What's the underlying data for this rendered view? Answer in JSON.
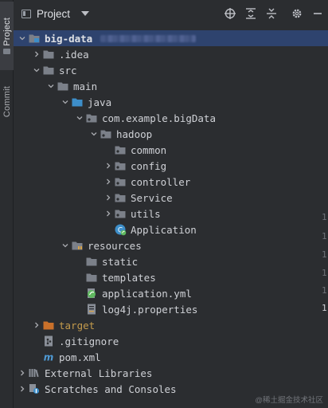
{
  "sidebar": {
    "project_tab": "Project",
    "commit_tab": "Commit"
  },
  "header": {
    "title": "Project"
  },
  "tree": [
    {
      "label": "big-data",
      "depth": 0,
      "arrow": "down",
      "icon": "module-folder",
      "selected": true,
      "bold": true,
      "blurred_path": true
    },
    {
      "label": ".idea",
      "depth": 1,
      "arrow": "right",
      "icon": "folder"
    },
    {
      "label": "src",
      "depth": 1,
      "arrow": "down",
      "icon": "folder"
    },
    {
      "label": "main",
      "depth": 2,
      "arrow": "down",
      "icon": "folder"
    },
    {
      "label": "java",
      "depth": 3,
      "arrow": "down",
      "icon": "source-folder"
    },
    {
      "label": "com.example.bigData",
      "depth": 4,
      "arrow": "down",
      "icon": "package"
    },
    {
      "label": "hadoop",
      "depth": 5,
      "arrow": "down",
      "icon": "package"
    },
    {
      "label": "common",
      "depth": 6,
      "arrow": "none",
      "icon": "package"
    },
    {
      "label": "config",
      "depth": 6,
      "arrow": "right",
      "icon": "package"
    },
    {
      "label": "controller",
      "depth": 6,
      "arrow": "right",
      "icon": "package"
    },
    {
      "label": "Service",
      "depth": 6,
      "arrow": "right",
      "icon": "package"
    },
    {
      "label": "utils",
      "depth": 6,
      "arrow": "right",
      "icon": "package"
    },
    {
      "label": "Application",
      "depth": 6,
      "arrow": "none",
      "icon": "spring-class"
    },
    {
      "label": "resources",
      "depth": 3,
      "arrow": "down",
      "icon": "resources-folder"
    },
    {
      "label": "static",
      "depth": 4,
      "arrow": "none",
      "icon": "folder"
    },
    {
      "label": "templates",
      "depth": 4,
      "arrow": "none",
      "icon": "folder"
    },
    {
      "label": "application.yml",
      "depth": 4,
      "arrow": "none",
      "icon": "spring-yml"
    },
    {
      "label": "log4j.properties",
      "depth": 4,
      "arrow": "none",
      "icon": "properties-file"
    },
    {
      "label": "target",
      "depth": 1,
      "arrow": "right",
      "icon": "excluded-folder",
      "orange": true
    },
    {
      "label": ".gitignore",
      "depth": 1,
      "arrow": "none",
      "icon": "gitignore-file"
    },
    {
      "label": "pom.xml",
      "depth": 1,
      "arrow": "none",
      "icon": "maven-file"
    },
    {
      "label": "External Libraries",
      "depth": 0,
      "arrow": "right",
      "icon": "libraries",
      "sans": true
    },
    {
      "label": "Scratches and Consoles",
      "depth": 0,
      "arrow": "right",
      "icon": "scratches",
      "sans": true
    }
  ],
  "gutter": [
    "1",
    "1",
    "1",
    "1",
    "1",
    "1"
  ],
  "watermark": "@稀土掘金技术社区",
  "colors": {
    "background": "#2b2d30",
    "selection": "#2e436e",
    "folder": "#7b8089",
    "source_folder": "#3d8ec9",
    "excluded_folder": "#c9702a",
    "spring": "#5fb85f"
  }
}
